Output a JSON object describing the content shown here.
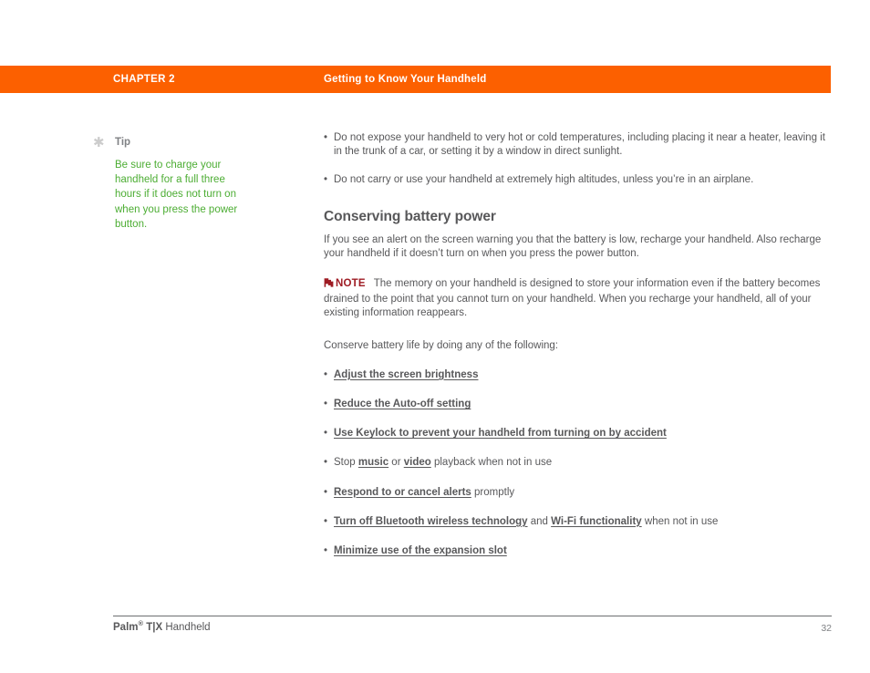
{
  "header": {
    "chapter": "CHAPTER 2",
    "section": "Getting to Know Your Handheld",
    "band_color": "#fc6000",
    "text_color": "#ffffff"
  },
  "tip": {
    "icon": "asterisk-icon",
    "label": "Tip",
    "body": "Be sure to charge your handheld for a full three hours if it does not turn on when you press the power button.",
    "text_color": "#4cad33",
    "label_color": "#808285"
  },
  "intro_bullets": [
    "Do not expose your handheld to very hot or cold temperatures, including placing it near a heater, leaving it in the trunk of a car, or setting it by a window in direct sunlight.",
    "Do not carry or use your handheld at extremely high altitudes, unless you’re in an airplane."
  ],
  "section": {
    "heading": "Conserving battery power",
    "intro": "If you see an alert on the screen warning you that the battery is low, recharge your handheld. Also recharge your handheld if it doesn’t turn on when you press the power button."
  },
  "note": {
    "icon": "note-flag-icon",
    "label": "NOTE",
    "label_color": "#9e1b23",
    "text": "The memory on your handheld is designed to store your information even if the battery becomes drained to the point that you cannot turn on your handheld. When you recharge your handheld, all of your existing information reappears."
  },
  "conserve": {
    "intro": "Conserve battery life by doing any of the following:",
    "items": [
      {
        "parts": [
          {
            "text": "Adjust the screen brightness",
            "link": true
          }
        ]
      },
      {
        "parts": [
          {
            "text": "Reduce the Auto-off setting",
            "link": true
          }
        ]
      },
      {
        "parts": [
          {
            "text": "Use Keylock to prevent your handheld from turning on by accident",
            "link": true
          }
        ]
      },
      {
        "parts": [
          {
            "text": "Stop ",
            "link": false
          },
          {
            "text": "music",
            "link": true
          },
          {
            "text": " or ",
            "link": false
          },
          {
            "text": "video",
            "link": true
          },
          {
            "text": " playback when not in use",
            "link": false
          }
        ]
      },
      {
        "parts": [
          {
            "text": "Respond to or cancel alerts",
            "link": true
          },
          {
            "text": " promptly",
            "link": false
          }
        ]
      },
      {
        "parts": [
          {
            "text": "Turn off Bluetooth wireless technology",
            "link": true
          },
          {
            "text": " and ",
            "link": false
          },
          {
            "text": "Wi-Fi functionality",
            "link": true
          },
          {
            "text": " when not in use",
            "link": false
          }
        ]
      },
      {
        "parts": [
          {
            "text": "Minimize use of the expansion slot",
            "link": true
          }
        ]
      }
    ]
  },
  "footer": {
    "brand": "Palm",
    "registered": "®",
    "model": " T|X",
    "product": " Handheld",
    "page_number": "32"
  }
}
